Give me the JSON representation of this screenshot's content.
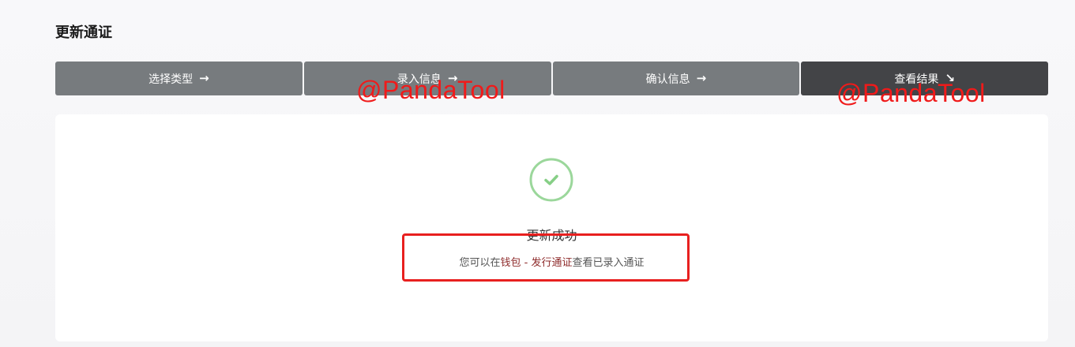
{
  "page": {
    "title": "更新通证"
  },
  "steps": [
    {
      "label": "选择类型",
      "arrow": "→"
    },
    {
      "label": "录入信息",
      "arrow": "→"
    },
    {
      "label": "确认信息",
      "arrow": "→"
    },
    {
      "label": "查看结果",
      "arrow": "↘"
    }
  ],
  "active_step": 3,
  "result": {
    "icon": "check-circle-icon",
    "title": "更新成功",
    "desc_prefix": "您可以在",
    "link_wallet": "钱包",
    "separator": " - ",
    "link_issue": "发行通证",
    "desc_suffix": "查看已录入通证"
  },
  "watermarks": [
    "@PandaTool",
    "@PandaTool"
  ],
  "colors": {
    "step_bg": "#777b7e",
    "step_active_bg": "#434447",
    "success_green": "#9bd79b",
    "link_color": "#8e2b2b",
    "annotation_red": "#e8201f"
  }
}
